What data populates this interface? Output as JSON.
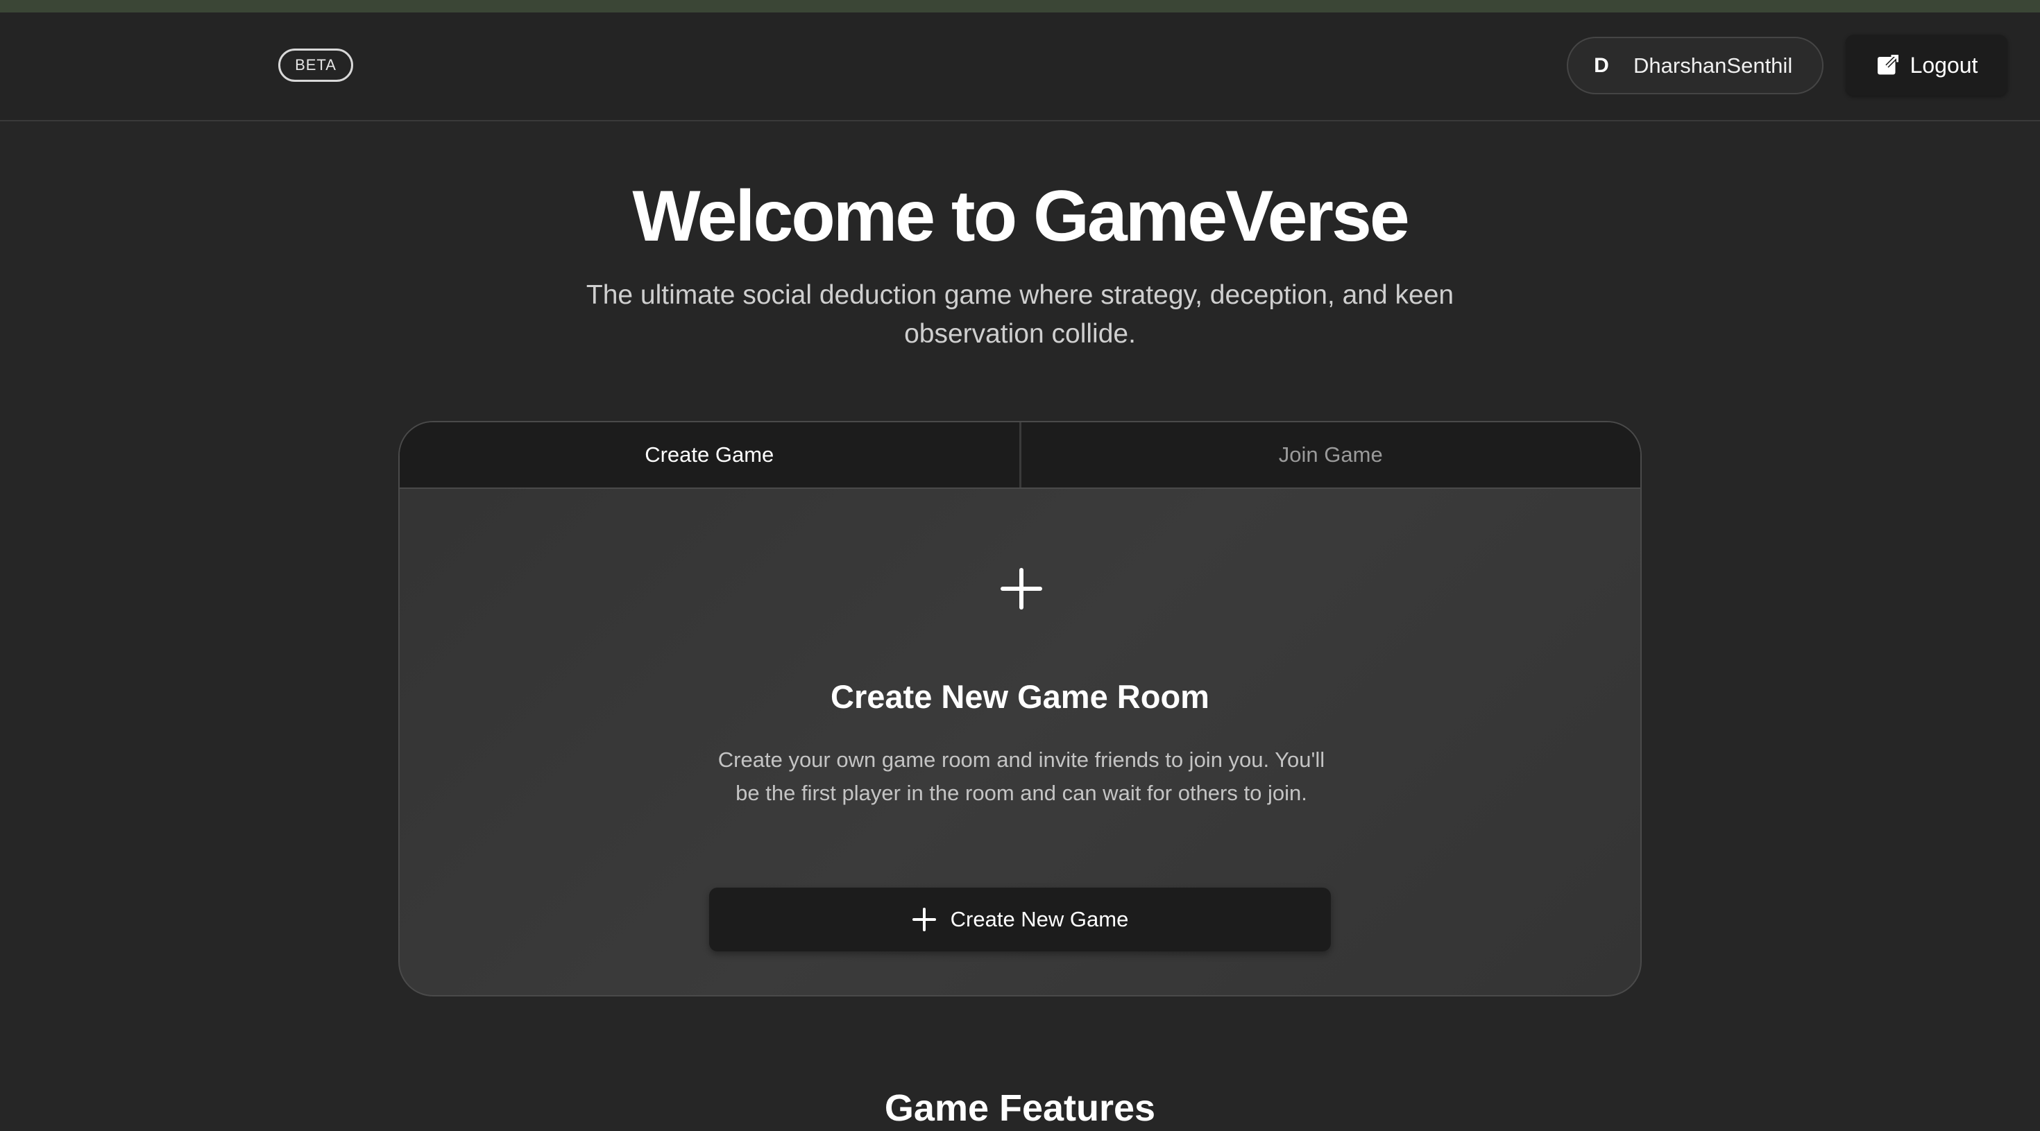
{
  "header": {
    "badge": "BETA",
    "user": {
      "avatar_initial": "D",
      "name": "DharshanSenthil"
    },
    "logout_label": "Logout",
    "logout_icon": "logout-icon"
  },
  "hero": {
    "title": "Welcome to GameVerse",
    "subtitle": "The ultimate social deduction game where strategy, deception, and keen observation collide."
  },
  "card": {
    "tabs": [
      {
        "label": "Create Game",
        "active": true
      },
      {
        "label": "Join Game",
        "active": false
      }
    ],
    "icon": "plus-icon",
    "title": "Create New Game Room",
    "description": "Create your own game room and invite friends to join you. You'll be the first player in the room and can wait for others to join.",
    "button_label": "Create New Game",
    "button_icon": "plus-icon"
  },
  "features": {
    "heading": "Game Features"
  },
  "colors": {
    "background": "#262626",
    "header": "#242424",
    "top_strip": "#3b4636",
    "card": "#383838",
    "button": "#1c1c1c",
    "text_muted": "#cfcfcf"
  }
}
